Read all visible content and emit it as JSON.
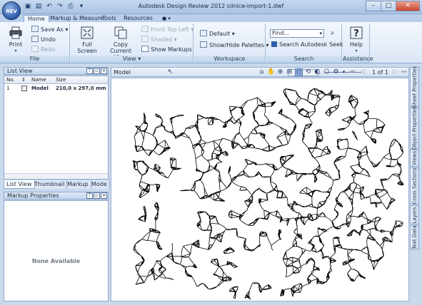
{
  "window": {
    "title": "Autodesk Design Review 2012   silnice-import-1.dwf",
    "app_logo_text": "REV",
    "controls": {
      "minimize": "–",
      "maximize": "□",
      "close": "✕"
    }
  },
  "quick_access": [
    "folder-icon",
    "save-icon",
    "undo-icon",
    "redo-icon",
    "print-icon",
    "dropdown-icon"
  ],
  "tabs": [
    {
      "label": "Home",
      "active": true
    },
    {
      "label": "Markup & Measure",
      "active": false
    },
    {
      "label": "Tools",
      "active": false
    },
    {
      "label": "Resources",
      "active": false
    }
  ],
  "ribbon": {
    "file": {
      "label": "File",
      "print": "Print",
      "save_as": "Save As",
      "undo": "Undo",
      "redo": "Redo"
    },
    "view": {
      "label": "View",
      "full_screen": "Full Screen",
      "copy_current_view": "Copy Current View",
      "front_top_left": "Front Top Left",
      "shaded": "Shaded",
      "show_markups": "Show Markups"
    },
    "workspace": {
      "label": "Workspace",
      "default": "Default",
      "show_hide_palettes": "Show/Hide Palettes"
    },
    "search": {
      "label": "Search",
      "find_value": "Find...",
      "search_seek": "Search Autodesk Seek"
    },
    "assistance": {
      "label": "Assistance",
      "help": "Help"
    }
  },
  "list_view": {
    "title": "List View",
    "columns": [
      "No.",
      "Name",
      "Size"
    ],
    "rows": [
      {
        "no": "1",
        "name": "Model",
        "size": "210,0 x 297,0 mm"
      }
    ]
  },
  "panel_tabs": [
    {
      "label": "List View",
      "active": true
    },
    {
      "label": "Thumbnail",
      "active": false
    },
    {
      "label": "Markup",
      "active": false
    },
    {
      "label": "Mode",
      "active": false
    }
  ],
  "markup_properties": {
    "title": "Markup Properties",
    "empty_text": "None Available"
  },
  "viewer": {
    "label": "Model",
    "page_of": "1 of 1"
  },
  "side_tabs": [
    "Sheet Properties",
    "Object Properties",
    "Views",
    "Cross Sections",
    "Layers",
    "Text Data"
  ]
}
